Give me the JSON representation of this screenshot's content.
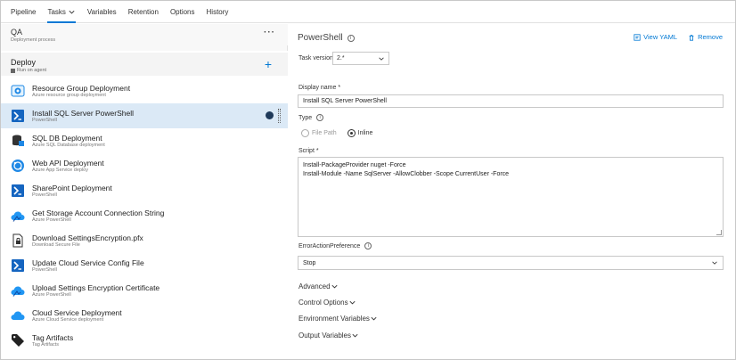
{
  "nav": {
    "tabs": [
      {
        "label": "Pipeline"
      },
      {
        "label": "Tasks"
      },
      {
        "label": "Variables"
      },
      {
        "label": "Retention"
      },
      {
        "label": "Options"
      },
      {
        "label": "History"
      }
    ],
    "active_index": 1
  },
  "stage": {
    "title": "QA",
    "subtitle": "Deployment process",
    "more": "···"
  },
  "job": {
    "title": "Deploy",
    "subtitle": "Run on agent",
    "add": "+"
  },
  "tasks": [
    {
      "title": "Resource Group Deployment",
      "subtitle": "Azure resource group deployment",
      "icon": "resource-group-icon"
    },
    {
      "title": "Install SQL Server PowerShell",
      "subtitle": "PowerShell",
      "icon": "powershell-icon"
    },
    {
      "title": "SQL DB Deployment",
      "subtitle": "Azure SQL Database deployment",
      "icon": "sql-db-icon"
    },
    {
      "title": "Web API Deployment",
      "subtitle": "Azure App Service deploy",
      "icon": "app-service-icon"
    },
    {
      "title": "SharePoint Deployment",
      "subtitle": "PowerShell",
      "icon": "powershell-icon"
    },
    {
      "title": "Get Storage Account Connection String",
      "subtitle": "Azure PowerShell",
      "icon": "azure-cloud-icon"
    },
    {
      "title": "Download SettingsEncryption.pfx",
      "subtitle": "Download Secure File",
      "icon": "secure-file-icon"
    },
    {
      "title": "Update Cloud Service Config File",
      "subtitle": "PowerShell",
      "icon": "powershell-icon"
    },
    {
      "title": "Upload Settings Encryption Certificate",
      "subtitle": "Azure PowerShell",
      "icon": "azure-cloud-icon"
    },
    {
      "title": "Cloud Service Deployment",
      "subtitle": "Azure Cloud Service deployment",
      "icon": "azure-cloud-icon"
    },
    {
      "title": "Tag Artifacts",
      "subtitle": "Tag Artifacts",
      "icon": "tag-icon"
    }
  ],
  "selected_task": 1,
  "detail": {
    "title": "PowerShell",
    "view_yaml": "View YAML",
    "remove": "Remove",
    "task_version_label": "Task version",
    "task_version_value": "2.*",
    "display_name_label": "Display name *",
    "display_name_value": "Install SQL Server PowerShell",
    "type_label": "Type",
    "type_options": [
      "File Path",
      "Inline"
    ],
    "type_selected": "Inline",
    "script_label": "Script *",
    "script_lines": [
      "Install-PackageProvider nuget -Force",
      "Install-Module -Name SqlServer -AllowClobber -Scope CurrentUser -Force"
    ],
    "error_pref_label": "ErrorActionPreference",
    "error_pref_value": "Stop",
    "sections": [
      "Advanced",
      "Control Options",
      "Environment Variables",
      "Output Variables"
    ]
  },
  "colors": {
    "accent": "#0078d4",
    "selected_row": "#dbe9f6",
    "powershell": "#1565c0",
    "azure": "#2196f3"
  }
}
